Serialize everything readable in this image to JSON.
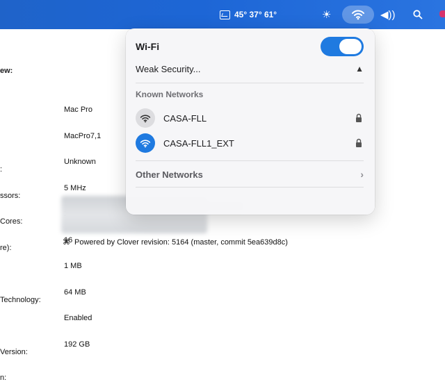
{
  "menubar": {
    "weather_temps": "45° 37° 61°"
  },
  "background": {
    "overview_label": "ew:",
    "hardware_labels": [
      "",
      "",
      ":",
      "ssors:",
      "Cores:",
      "re):",
      "",
      "Technology:",
      "",
      "Version:",
      "n:"
    ],
    "hardware_values": [
      "Mac Pro",
      "MacPro7,1",
      "Unknown",
      "5 MHz",
      "1",
      "16",
      "1 MB",
      "64 MB",
      "Enabled",
      "192 GB"
    ],
    "footer_symbol": "⌘",
    "footer_text": "Powered by Clover revision: 5164 (master, commit 5ea639d8c)"
  },
  "wifi_panel": {
    "title": "Wi-Fi",
    "toggle_on": true,
    "weak_security_label": "Weak Security...",
    "known_networks_header": "Known Networks",
    "networks": [
      {
        "name": "CASA-FLL",
        "connected": false,
        "locked": true
      },
      {
        "name": "CASA-FLL1_EXT",
        "connected": true,
        "locked": true
      }
    ],
    "other_networks_label": "Other Networks"
  },
  "colors": {
    "accent": "#1f7ae0",
    "menubar": "#1d66d6"
  }
}
